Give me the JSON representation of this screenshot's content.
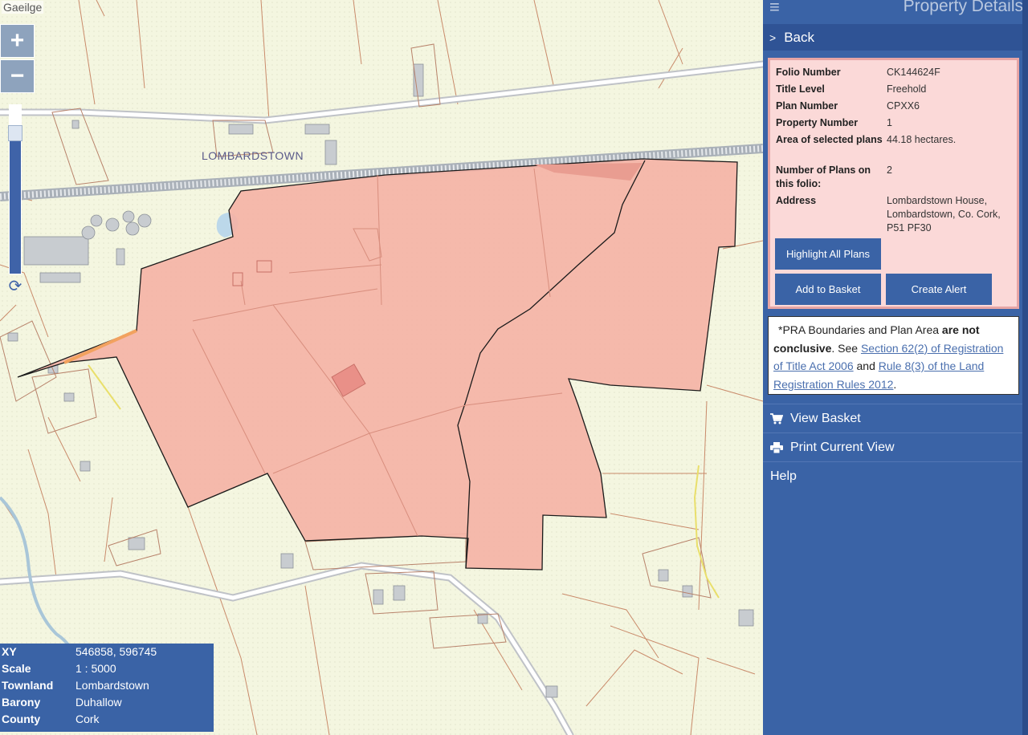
{
  "map": {
    "language_link": "Gaeilge",
    "zoom_in": "+",
    "zoom_out": "−",
    "townland_label": "LOMBARDSTOWN"
  },
  "info_box": [
    {
      "key": "XY",
      "value": "546858, 596745"
    },
    {
      "key": "Scale",
      "value": "1 : 5000"
    },
    {
      "key": "Townland",
      "value": "Lombardstown"
    },
    {
      "key": "Barony",
      "value": "Duhallow"
    },
    {
      "key": "County",
      "value": "Cork"
    }
  ],
  "sidebar": {
    "title": "Property Details",
    "back_label": "Back",
    "details": {
      "folio_number_label": "Folio Number",
      "folio_number": "CK144624F",
      "title_level_label": "Title Level",
      "title_level": "Freehold",
      "plan_number_label": "Plan Number",
      "plan_number": "CPXX6",
      "property_number_label": "Property Number",
      "property_number": "1",
      "area_label": "Area of selected plans",
      "area": "44.18 hectares.",
      "plans_count_label": "Number of Plans on this folio:",
      "plans_count": "2",
      "address_label": "Address",
      "address": "Lombardstown House, Lombardstown, Co. Cork, P51 PF30"
    },
    "buttons": {
      "highlight_all": "Highlight All Plans",
      "add_to_basket": "Add to Basket",
      "create_alert": "Create Alert"
    },
    "disclaimer": {
      "text1": "*PRA Boundaries and Plan Area ",
      "bold": "are not conclusive",
      "text2": ". See ",
      "link1": "Section 62(2) of Registration of Title Act 2006",
      "text3": " and ",
      "link2": "Rule 8(3) of the Land Registration Rules 2012",
      "text4": "."
    },
    "links": {
      "view_basket": "View Basket",
      "print_view": "Print Current View",
      "help": "Help"
    }
  },
  "colors": {
    "sidebar_blue": "#3a63a6",
    "plot_fill": "#f4b3a6",
    "panel_pink": "#fbd9d8"
  }
}
